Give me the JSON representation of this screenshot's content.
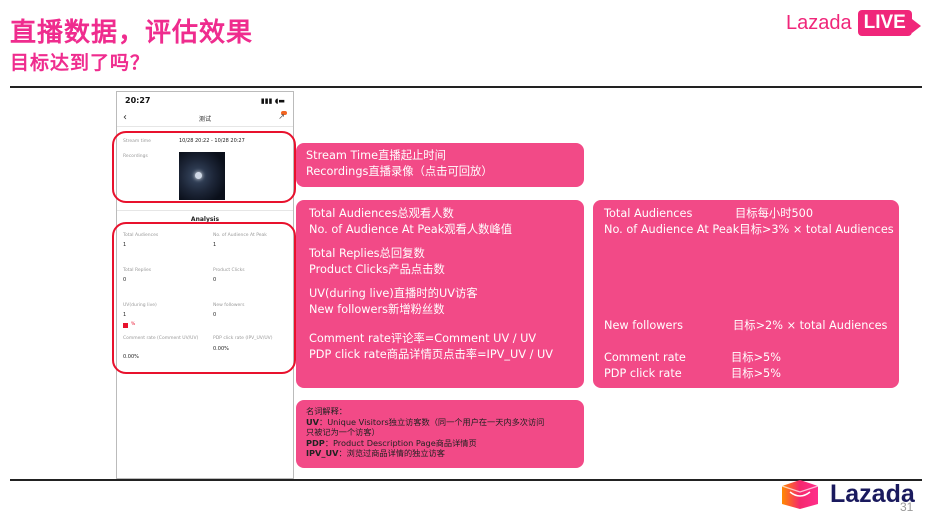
{
  "slide": {
    "title": "直播数据，评估效果",
    "subtitle": "目标达到了吗？",
    "page_number": "31"
  },
  "brand": {
    "top_word": "Lazada",
    "top_live": "LIVE",
    "bottom_word": "Lazada",
    "accent": "#f0267a"
  },
  "phone": {
    "time": "20:27",
    "title": "测试",
    "stream_time_label": "Stream time",
    "stream_time_value": "10/28 20:22 - 10/28 20:27",
    "recordings_label": "Recordings",
    "analysis_heading": "Analysis",
    "metrics": [
      {
        "label": "Total Audiences",
        "value": "1"
      },
      {
        "label": "No. of Audience At Peak",
        "value": "1"
      },
      {
        "label": "Total Replies",
        "value": "0"
      },
      {
        "label": "Product Clicks",
        "value": "0"
      },
      {
        "label": "UV(during live)",
        "value": "1"
      },
      {
        "label": "New followers",
        "value": "0"
      },
      {
        "label": "Comment rate (Comment UV/UV)",
        "value": "0.00%"
      },
      {
        "label": "PDP click rate (IPV_UV/UV)",
        "value": "0.00%"
      }
    ],
    "legend_mark": "%"
  },
  "box1": {
    "lines": [
      "Stream Time直播起止时间",
      "Recordings直播录像（点击可回放）"
    ]
  },
  "box2": {
    "groups": [
      [
        "Total Audiences总观看人数",
        "No. of Audience At Peak观看人数峰值"
      ],
      [
        "Total Replies总回复数",
        "Product Clicks产品点击数"
      ],
      [
        "UV(during live)直播时的UV访客",
        "New followers新增粉丝数"
      ],
      [
        "Comment rate评论率=Comment UV / UV",
        "PDP click rate商品详情页点击率=IPV_UV / UV"
      ]
    ]
  },
  "box3": {
    "targets": [
      {
        "metric": "Total Audiences",
        "goal": "目标每小时500"
      },
      {
        "metric": "No. of Audience At Peak",
        "goal": "目标>3% × total Audiences"
      },
      {
        "metric": "New followers",
        "goal": "目标>2% × total Audiences"
      },
      {
        "metric": "Comment rate",
        "goal": "目标>5%"
      },
      {
        "metric": "PDP click rate",
        "goal": "目标>5%"
      }
    ]
  },
  "definitions": {
    "heading": "名词解释：",
    "uv_key": "UV",
    "uv_text": "：Unique Visitors独立访客数（同一个用户在一天内多次访问",
    "uv_text2": "只被记为一个访客）",
    "pdp_key": "PDP",
    "pdp_text": "：Product Description Page商品详情页",
    "ipv_key": "IPV_UV",
    "ipv_text": "：浏览过商品详情的独立访客"
  }
}
